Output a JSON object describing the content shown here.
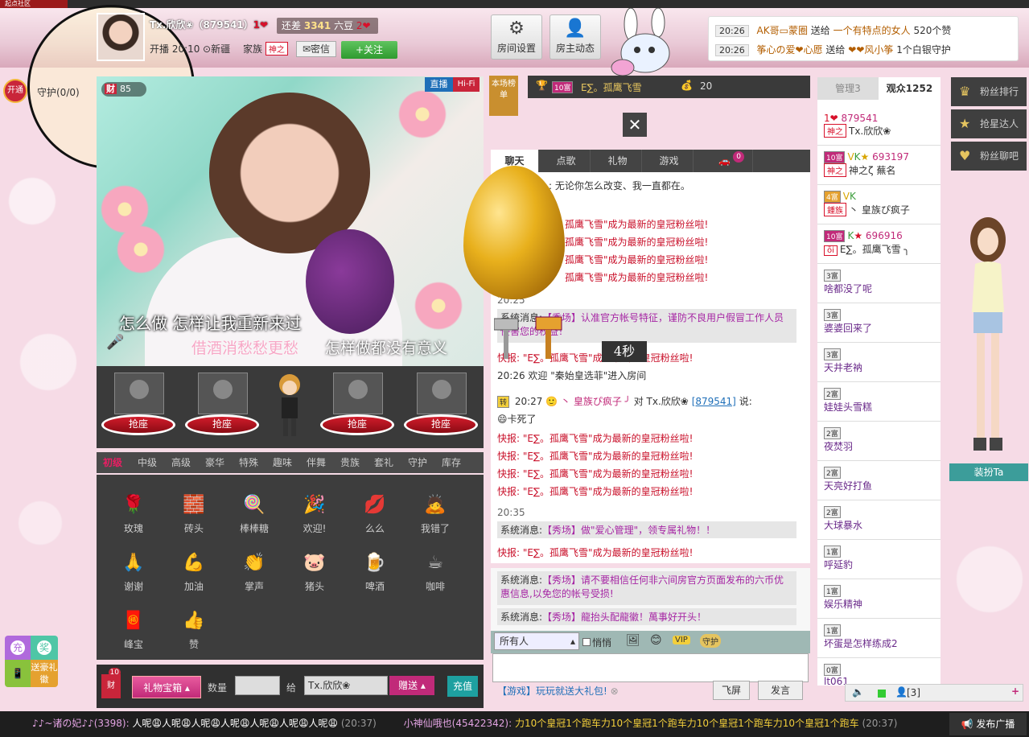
{
  "topstrip": {
    "label": "起点社区"
  },
  "anchor": {
    "name": "Tx.欣欣❀（879541）",
    "need_label": "还差",
    "need_value": "3341",
    "need_unit": "六豆",
    "live_time": "开播 20:10",
    "location": "新疆",
    "family_label": "家族",
    "family_tag": "神之",
    "msg_btn": "密信",
    "follow_btn": "+关注"
  },
  "toolbar": {
    "room_settings": "房间设置",
    "owner_feed": "房主动态"
  },
  "gift_notices": [
    {
      "time": "20:26",
      "from": "AK哥▭蒙圈",
      "verb": "送给",
      "to": "一个有特点的女人",
      "detail": "520个赞"
    },
    {
      "time": "20:26",
      "from": "筝心の爱❤心愿",
      "verb": "送给",
      "to": "❤❤风小筝",
      "detail": "1个白银守护"
    }
  ],
  "guard": {
    "open": "开通",
    "label": "守护(0/0)"
  },
  "video": {
    "badge_cai": "财",
    "badge_num": "85",
    "live": "直播",
    "hifi": "Hi-Fi",
    "lyric1": "怎么做  怎样让我重新来过",
    "lyric2": "借酒消愁愁更愁",
    "lyric3": "怎样做都没有意义"
  },
  "seats": [
    "抢座",
    "抢座",
    "抢座",
    "抢座"
  ],
  "gift_tabs": [
    "初级",
    "中级",
    "高级",
    "豪华",
    "特殊",
    "趣味",
    "伴舞",
    "贵族",
    "套礼",
    "守护",
    "库存"
  ],
  "gifts": [
    {
      "icon": "rose-icon",
      "glyph": "🌹",
      "name": "玫瑰"
    },
    {
      "icon": "brick-icon",
      "glyph": "🧱",
      "name": "砖头"
    },
    {
      "icon": "lollipop-icon",
      "glyph": "🍭",
      "name": "棒棒糖"
    },
    {
      "icon": "welcome-icon",
      "glyph": "🎉",
      "name": "欢迎!"
    },
    {
      "icon": "lips-icon",
      "glyph": "💋",
      "name": "么么"
    },
    {
      "icon": "sorry-icon",
      "glyph": "🙇",
      "name": "我错了"
    },
    {
      "icon": "thanks-icon",
      "glyph": "🙏",
      "name": "谢谢"
    },
    {
      "icon": "cheer-icon",
      "glyph": "💪",
      "name": "加油"
    },
    {
      "icon": "applause-icon",
      "glyph": "👏",
      "name": "掌声"
    },
    {
      "icon": "pig-icon",
      "glyph": "🐷",
      "name": "猪头"
    },
    {
      "icon": "beer-icon",
      "glyph": "🍺",
      "name": "啤酒"
    },
    {
      "icon": "coffee-icon",
      "glyph": "☕",
      "name": "咖啡"
    },
    {
      "icon": "treasure-icon",
      "glyph": "🧧",
      "name": "峰宝"
    },
    {
      "icon": "thumb-icon",
      "glyph": "👍",
      "name": "赞"
    }
  ],
  "gift_bar": {
    "cai": "财",
    "cai_num": "10",
    "box_label": "礼物宝箱",
    "qty_label": "数量",
    "to_label": "给",
    "to_value": "Tx.欣欣❀",
    "send_label": "赠送",
    "recharge_label": "充值"
  },
  "board": {
    "tag": "本场榜单",
    "rank_name": "E∑。孤鹰飞雪",
    "rank_level": "10富",
    "score": "20"
  },
  "chat_tabs": [
    "聊天",
    "点歌",
    "礼物",
    "游戏"
  ],
  "car_badge": "0",
  "chat": {
    "line_top": "】: 无论你怎么改变、我一直都在。",
    "kuaibao": "快报: \"E∑。孤鹰飞雪\"成为最新的皇冠粉丝啦!",
    "kuaibao_partial": "孤鹰飞雪\"成为最新的皇冠粉丝啦!",
    "time1": "20:25",
    "sys_label": "系统消息:",
    "sys1": "【秀场】认准官方帐号特征，谨防不良用户假冒工作人员侵害您的权益！",
    "welcome": "20:26 欢迎 \"秦始皇选菲\"进入房间",
    "user_time": "20:27",
    "user_name": "丶 皇族ぴ疯子 ╯",
    "user_to": "对 Tx.欣欣❀",
    "user_id": "[879541]",
    "user_say": "说:",
    "user_msg": "卡死了",
    "time2": "20:35",
    "sys2": "【秀场】做\"爱心管理\"，领专属礼物！！",
    "sys3": "【秀场】请不要相信任何非六间房官方页面发布的六币优惠信息,以免您的帐号受损!",
    "sys4": "【秀场】龍抬头配龍徽！萬事好开头！",
    "timer": "4秒"
  },
  "chat_input": {
    "target": "所有人",
    "private": "悄悄",
    "game_msg": "【游戏】玩玩就送大礼包!",
    "fly_screen": "飞屏",
    "speak": "发言"
  },
  "audience": {
    "tab_admin": "管理3",
    "tab_viewers": "观众1252",
    "items": [
      {
        "lv": "",
        "ident": "神之",
        "id": "879541",
        "name": "Tx.欣欣❀"
      },
      {
        "lv": "10富",
        "ident": "神之",
        "id": "693197",
        "name": "神之ζ     蕪名"
      },
      {
        "lv": "4富",
        "ident": "鍾族",
        "id": "",
        "name": "丶 皇族ぴ疯子"
      },
      {
        "lv": "10富",
        "ident": "ōi",
        "id": "696916",
        "name": "E∑。孤鹰飞雪 ╮"
      },
      {
        "lv": "3富",
        "ident": "",
        "id": "",
        "name": "啥都没了呢"
      },
      {
        "lv": "3富",
        "ident": "",
        "id": "",
        "name": "婆婆回来了"
      },
      {
        "lv": "3富",
        "ident": "",
        "id": "",
        "name": "天井老衲"
      },
      {
        "lv": "2富",
        "ident": "",
        "id": "",
        "name": "娃娃头雪糕"
      },
      {
        "lv": "2富",
        "ident": "",
        "id": "",
        "name": "夜焚羽"
      },
      {
        "lv": "2富",
        "ident": "",
        "id": "",
        "name": "天亮好打鱼"
      },
      {
        "lv": "2富",
        "ident": "",
        "id": "",
        "name": "大球暴水"
      },
      {
        "lv": "1富",
        "ident": "",
        "id": "",
        "name": "呼延豹"
      },
      {
        "lv": "1富",
        "ident": "",
        "id": "",
        "name": "娱乐精神"
      },
      {
        "lv": "1富",
        "ident": "",
        "id": "",
        "name": "坏蛋是怎样练成2"
      },
      {
        "lv": "0富",
        "ident": "",
        "id": "",
        "name": "lt061"
      }
    ],
    "footer_count": "[3]"
  },
  "right_side": [
    {
      "icon": "crown-icon",
      "glyph": "♛",
      "label": "粉丝排行"
    },
    {
      "icon": "star-icon",
      "glyph": "★",
      "label": "抢星达人"
    },
    {
      "icon": "heart-icon",
      "glyph": "♥",
      "label": "粉丝聊吧"
    }
  ],
  "dress_label": "装扮Ta",
  "mini": {
    "chong": "充",
    "jiang": "奖",
    "gift_label": "送豪礼徽"
  },
  "footer": {
    "user1": "♪♪~诸の妃♪♪(3398):",
    "msg1": "人呢😩人呢😩人呢😩人呢😩人呢😩人呢😩人呢😩",
    "time1": "(20:37)",
    "user2": "小神仙哦也(45422342):",
    "msg2": "力10个皇冠1个跑车力10个皇冠1个跑车力10个皇冠1个跑车力10个皇冠1个跑车",
    "time2": "(20:37)",
    "publish": "发布广播"
  }
}
